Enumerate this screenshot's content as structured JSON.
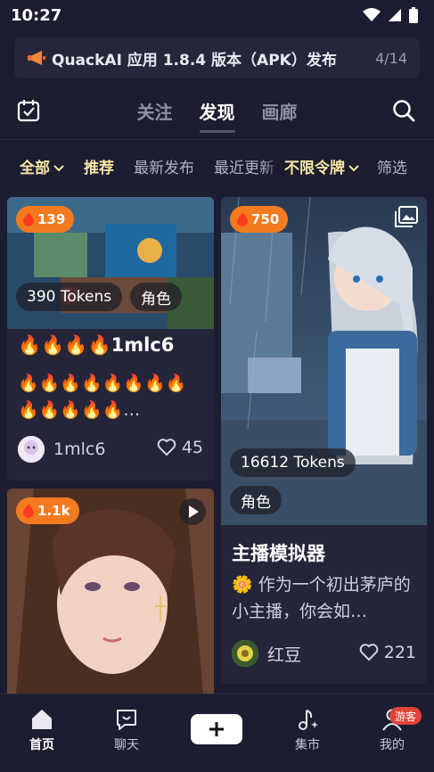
{
  "status": {
    "time": "10:27"
  },
  "announcement": {
    "icon": "megaphone-icon",
    "title": "QuackAI 应用 1.8.4 版本（APK）发布",
    "counter": "4/14"
  },
  "topnav": {
    "tabs": [
      "关注",
      "发现",
      "画廊"
    ],
    "active": "发现"
  },
  "filters": {
    "all": "全部",
    "recommend": "推荐",
    "latest": "最新发布",
    "recent": "最近更新",
    "tokens": "不限令牌",
    "screen": "筛选"
  },
  "cards": [
    {
      "heat": "139",
      "tokens": "390 Tokens",
      "tag": "角色",
      "title": "🔥🔥🔥🔥1mlc6",
      "desc": "🔥🔥🔥🔥🔥🔥🔥🔥🔥🔥🔥🔥🔥…",
      "author": "1mlc6",
      "likes": "45"
    },
    {
      "heat": "750",
      "tokens": "16612 Tokens",
      "tag": "角色",
      "title": "主播模拟器",
      "desc": "🌼 作为一个初出茅庐的小主播，你会如…",
      "author": "红豆",
      "likes": "221"
    },
    {
      "heat": "1.1k"
    }
  ],
  "bottomnav": {
    "home": "首页",
    "chat": "聊天",
    "market": "集市",
    "me": "我的",
    "badge": "游客"
  },
  "colors": {
    "background": "#1d1d31",
    "accent": "#f47a1f",
    "filter_highlight": "#f7e6a4",
    "badge": "#e04438"
  }
}
